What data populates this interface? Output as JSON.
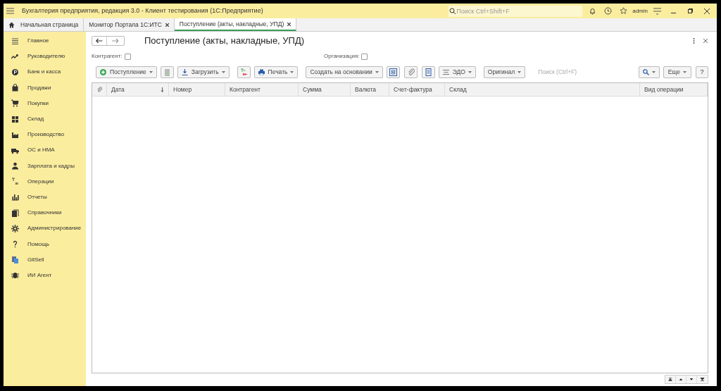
{
  "window": {
    "title": "Бухгалтерия предприятия, редакция 3.0  - Клиент тестирования (1С:Предприятие)",
    "search": {
      "placeholder": "Поиск Ctrl+Shift+F"
    },
    "user": "admin"
  },
  "tabs": [
    {
      "label": "Начальная страница",
      "selected": false,
      "kind": "home"
    },
    {
      "label": "Монитор Портала 1С:ИТС",
      "selected": false,
      "kind": "doc"
    },
    {
      "label": "Поступление (акты, накладные, УПД)",
      "selected": true,
      "kind": "doc"
    }
  ],
  "sidebar": {
    "items": [
      {
        "label": "Главное"
      },
      {
        "label": "Руководителю"
      },
      {
        "label": "Банк и касса"
      },
      {
        "label": "Продажи"
      },
      {
        "label": "Покупки"
      },
      {
        "label": "Склад"
      },
      {
        "label": "Производство"
      },
      {
        "label": "ОС и НМА"
      },
      {
        "label": "Зарплата и кадры"
      },
      {
        "label": "Операции"
      },
      {
        "label": "Отчеты"
      },
      {
        "label": "Справочники"
      },
      {
        "label": "Администрирование"
      },
      {
        "label": "Помощь"
      },
      {
        "label": "GitSell"
      },
      {
        "label": "ИИ Агент"
      }
    ]
  },
  "form": {
    "title": "Поступление (акты, накладные, УПД)",
    "filters": [
      {
        "label": "Контрагент:",
        "checked": false
      },
      {
        "label": "Организация:",
        "checked": false
      }
    ],
    "toolbar": {
      "buttons": [
        {
          "kind": "add",
          "label": "Поступление"
        },
        {
          "kind": "grey"
        },
        {
          "kind": "load",
          "label": "Загрузить"
        },
        {
          "kind": "dtkt"
        },
        {
          "kind": "print",
          "label": "Печать"
        },
        {
          "kind": "menu",
          "label": "Создать на основании"
        },
        {
          "kind": "struct"
        },
        {
          "kind": "clip"
        },
        {
          "kind": "list"
        },
        {
          "kind": "edo",
          "label": "ЭДО"
        },
        {
          "kind": "menu",
          "label": "Оригинал"
        }
      ],
      "search": {
        "placeholder": "Поиск (Ctrl+F)"
      },
      "more": "Еще",
      "help": "?"
    },
    "table": {
      "columns": [
        "Дата",
        "Номер",
        "Контрагент",
        "Сумма",
        "Валюта",
        "Счет-фактура",
        "Склад",
        "Вид операции"
      ]
    }
  }
}
